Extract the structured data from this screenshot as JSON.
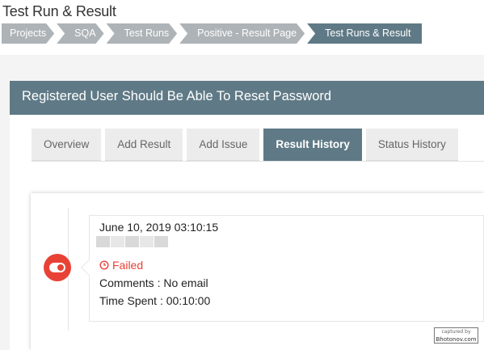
{
  "page": {
    "title": "Test Run & Result"
  },
  "breadcrumb": [
    {
      "label": "Projects"
    },
    {
      "label": "SQA"
    },
    {
      "label": "Test Runs"
    },
    {
      "label": "Positive - Result Page"
    },
    {
      "label": "Test Runs & Result"
    }
  ],
  "card": {
    "title": "Registered User Should Be Able To Reset Password"
  },
  "tabs": [
    {
      "label": "Overview"
    },
    {
      "label": "Add Result"
    },
    {
      "label": "Add Issue"
    },
    {
      "label": "Result History",
      "active": true
    },
    {
      "label": "Status History"
    }
  ],
  "history": {
    "entries": [
      {
        "date": "June 10, 2019 03:10:15",
        "status": "Failed",
        "comments": "Comments : No email",
        "time_spent": "Time Spent : 00:10:00"
      }
    ]
  },
  "watermark": {
    "line1": "captured by",
    "line2": "Bhotonov.com"
  },
  "colors": {
    "header_bg": "#5f7a86",
    "breadcrumb_bg": "#adb3b7",
    "failed": "#e84237",
    "tab_bg": "#ececec"
  },
  "icons": {
    "status": "toggle-icon",
    "failed": "clock-icon"
  }
}
